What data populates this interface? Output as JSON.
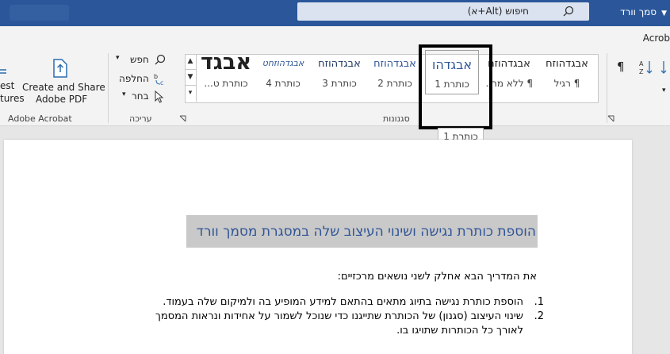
{
  "titlebar": {
    "doc_title": "סמך וורד",
    "search_placeholder": "חיפוש (Alt+א)"
  },
  "tabs": {
    "acrobat": "Acrob"
  },
  "ribbon": {
    "acrobat_group": {
      "label": "Adobe Acrobat",
      "create_share_line1": "Create and Share",
      "create_share_line2": "Adobe PDF",
      "request_line1": "est",
      "request_line2": "tures"
    },
    "editing_group": {
      "label": "עריכה",
      "find": "חפש",
      "replace": "החלפה",
      "select": "בחר"
    },
    "styles_group": {
      "label": "סגנונות",
      "items": [
        {
          "sample": "אבגדהוזח",
          "name": "¶ רגיל"
        },
        {
          "sample": "אבגדהוזח",
          "name": "¶ ללא מר..."
        },
        {
          "sample": "אבגדהו",
          "name": "כותרת 1"
        },
        {
          "sample": "אבגדהוזח",
          "name": "כותרת 2"
        },
        {
          "sample": "אבגדהוזח",
          "name": "כותרת 3"
        },
        {
          "sample": "אבגדהוזחט",
          "name": "כותרת 4"
        },
        {
          "sample": "אבגד",
          "name": "כותרת ט..."
        }
      ]
    }
  },
  "tooltip": "כותרת 1",
  "document": {
    "heading": "הוספת כותרת נגישה ושינוי העיצוב שלה במסגרת מסמך וורד",
    "intro": "את המדריך הבא אחלק לשני נושאים מרכזיים:",
    "list": [
      {
        "num": "1.",
        "text": "הוספת כותרת נגישה בתיוג מתאים בהתאם למידע המופיע בה ולמיקום שלה בעמוד."
      },
      {
        "num": "2.",
        "text": "שינוי העיצוב (סגנון) של הכותרת שתייגנו כדי שנוכל לשמור על אחידות ונראות המסמך"
      },
      {
        "num": "",
        "text": "לאורך כל הכותרות שתויגו בו."
      }
    ]
  }
}
